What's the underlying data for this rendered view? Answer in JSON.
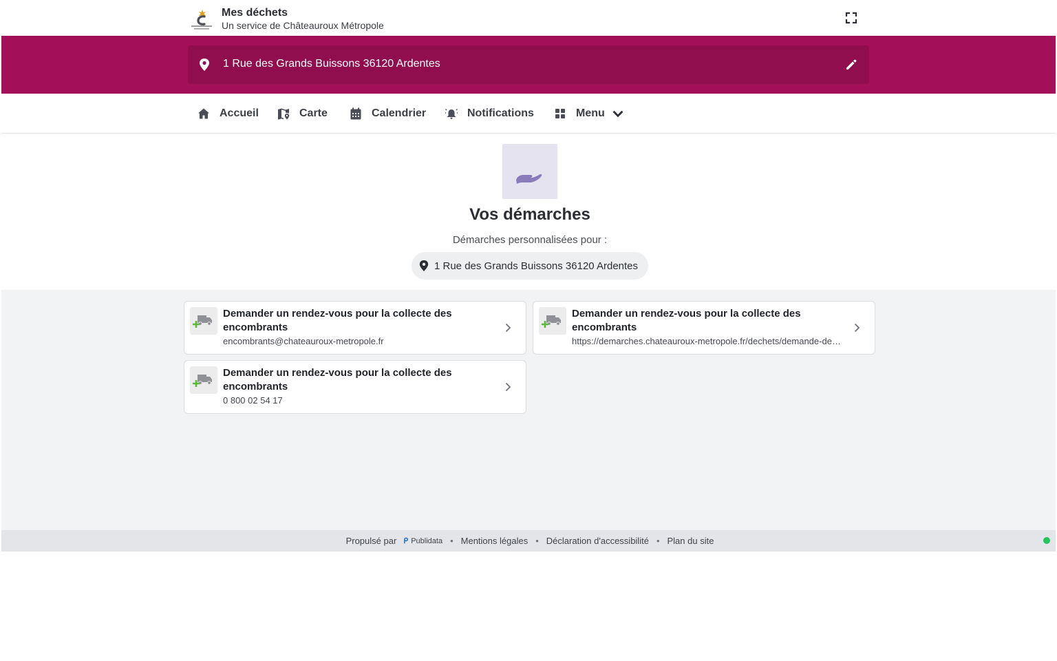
{
  "header": {
    "title": "Mes déchets",
    "subtitle": "Un service de Châteauroux Métropole",
    "logo_icon": "chateauroux-metropole-logo",
    "logo_text": "CHÂTEAUROUX MÉTROPOLE"
  },
  "address": {
    "text": "1 Rue des Grands Buissons 36120 Ardentes",
    "pin_icon": "map-pin-icon",
    "edit_icon": "pencil-icon"
  },
  "nav": {
    "items": [
      {
        "label": "Accueil",
        "icon": "home-icon"
      },
      {
        "label": "Carte",
        "icon": "map-icon"
      },
      {
        "label": "Calendrier",
        "icon": "calendar-icon"
      },
      {
        "label": "Notifications",
        "icon": "bell-icon"
      },
      {
        "label": "Menu",
        "icon": "grid-icon"
      }
    ]
  },
  "hero": {
    "icon": "hand-icon",
    "title": "Vos démarches",
    "subtitle": "Démarches personnalisées pour :",
    "address": "1 Rue des Grands Buissons 36120 Ardentes"
  },
  "cards": [
    {
      "title": "Demander un rendez-vous pour la collecte des encombrants",
      "sub": "encombrants@chateauroux-metropole.fr",
      "icon": "truck-icon"
    },
    {
      "title": "Demander un rendez-vous pour la collecte des encombrants",
      "sub": "https://demarches.chateauroux-metropole.fr/dechets/demande-de-rendez-vous-pour-la-collecte-des-encombrants",
      "icon": "truck-icon"
    },
    {
      "title": "Demander un rendez-vous pour la collecte des encombrants",
      "sub": "0 800 02 54 17",
      "icon": "truck-icon"
    }
  ],
  "footer": {
    "powered": "Propulsé par",
    "publidata": "Publidata",
    "links": [
      "Mentions légales",
      "Déclaration d'accessibilité",
      "Plan du site"
    ],
    "separator": "•"
  },
  "colors": {
    "brand": "#a30f58",
    "brand_dark": "#900d4e",
    "hero_icon_bg": "#e6e3f0",
    "hero_icon": "#8a7bbd",
    "status": "#22c55e"
  }
}
